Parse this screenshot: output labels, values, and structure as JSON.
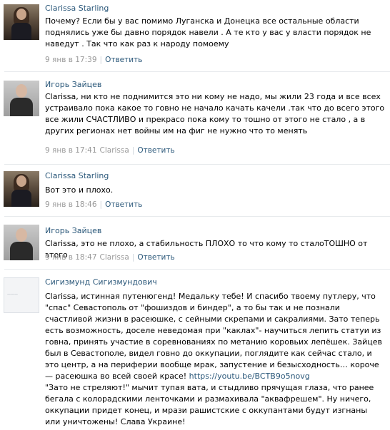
{
  "comments": [
    {
      "author": "Clarissa Starling",
      "avatar": "clarissa-photo",
      "text": "Почему? Если бы у вас помимо Луганска и Донецка все остальные области поднялись уже бы давно порядок навели . А те кто у вас у власти порядок не наведут . Так что как раз к народу помоему",
      "date": "9 янв в 17:39",
      "to": "",
      "reply": "Ответить"
    },
    {
      "author": "Игорь Зайцев",
      "avatar": "igor-photo",
      "text": "Clarissa, ни кто не поднимится это ни кому не надо, мы жили 23 года и все всех устраивало пока какое то говно не начало качать качели .так что до всего этого все жили СЧАСТЛИВО и прекрасо пока кому то тошно от этого не стало , а в других регионах нет войны им на фиг не нужно что то менять",
      "date": "9 янв в 17:41",
      "to": "Clarissa",
      "reply": "Ответить"
    },
    {
      "author": "Clarissa Starling",
      "avatar": "clarissa-photo",
      "text": "Вот это и плохо.",
      "date": "9 янв в 18:46",
      "to": "",
      "reply": "Ответить"
    },
    {
      "author": "Игорь Зайцев",
      "avatar": "igor-photo",
      "text": "Clarissa, это не плохо, а стабильность ПЛОХО то что кому то сталоТОШНО от этого",
      "date": "9 янв в 18:47",
      "to": "Clarissa",
      "reply": "Ответить"
    },
    {
      "author": "Сигизмунд Сигизмундович",
      "avatar": "sigizmund-logo",
      "text": "Clarissa, истинная путенюгенд! Медальку тебе! И спасибо твоему путлеру, что \"спас\" Севастополь от \"фошиздов и биндер\", а то бы так и не познали счастливой жизни в расеюшке, с сейными скрепами и сакралиями. Зато теперь есть возможность, доселе неведомая при \"каклах\"- научиться лепить статуи из говна, принять участие в соревнованиях по метанию коровьих лепёшек. Зайцев был в Севастополе, видел говно до оккупации, поглядите как сейчас стало, и это центр, а на периферии вообще мрак, запустение и безысходность… короче — расеюшка во всей своей красе!",
      "link": "https://youtu.be/BCTB9o5novg",
      "text2": "\"Зато не стреляют!\" мычит тупая вата, и стыдливо прячущая глаза, что ранее бегала с колорадскими ленточками и размахивала \"аквафрешем\". Ну ничего, оккупации придет конец, и мрази рашистские с оккупантами будут изгнаны или уничтожены! Слава Украине!"
    }
  ]
}
